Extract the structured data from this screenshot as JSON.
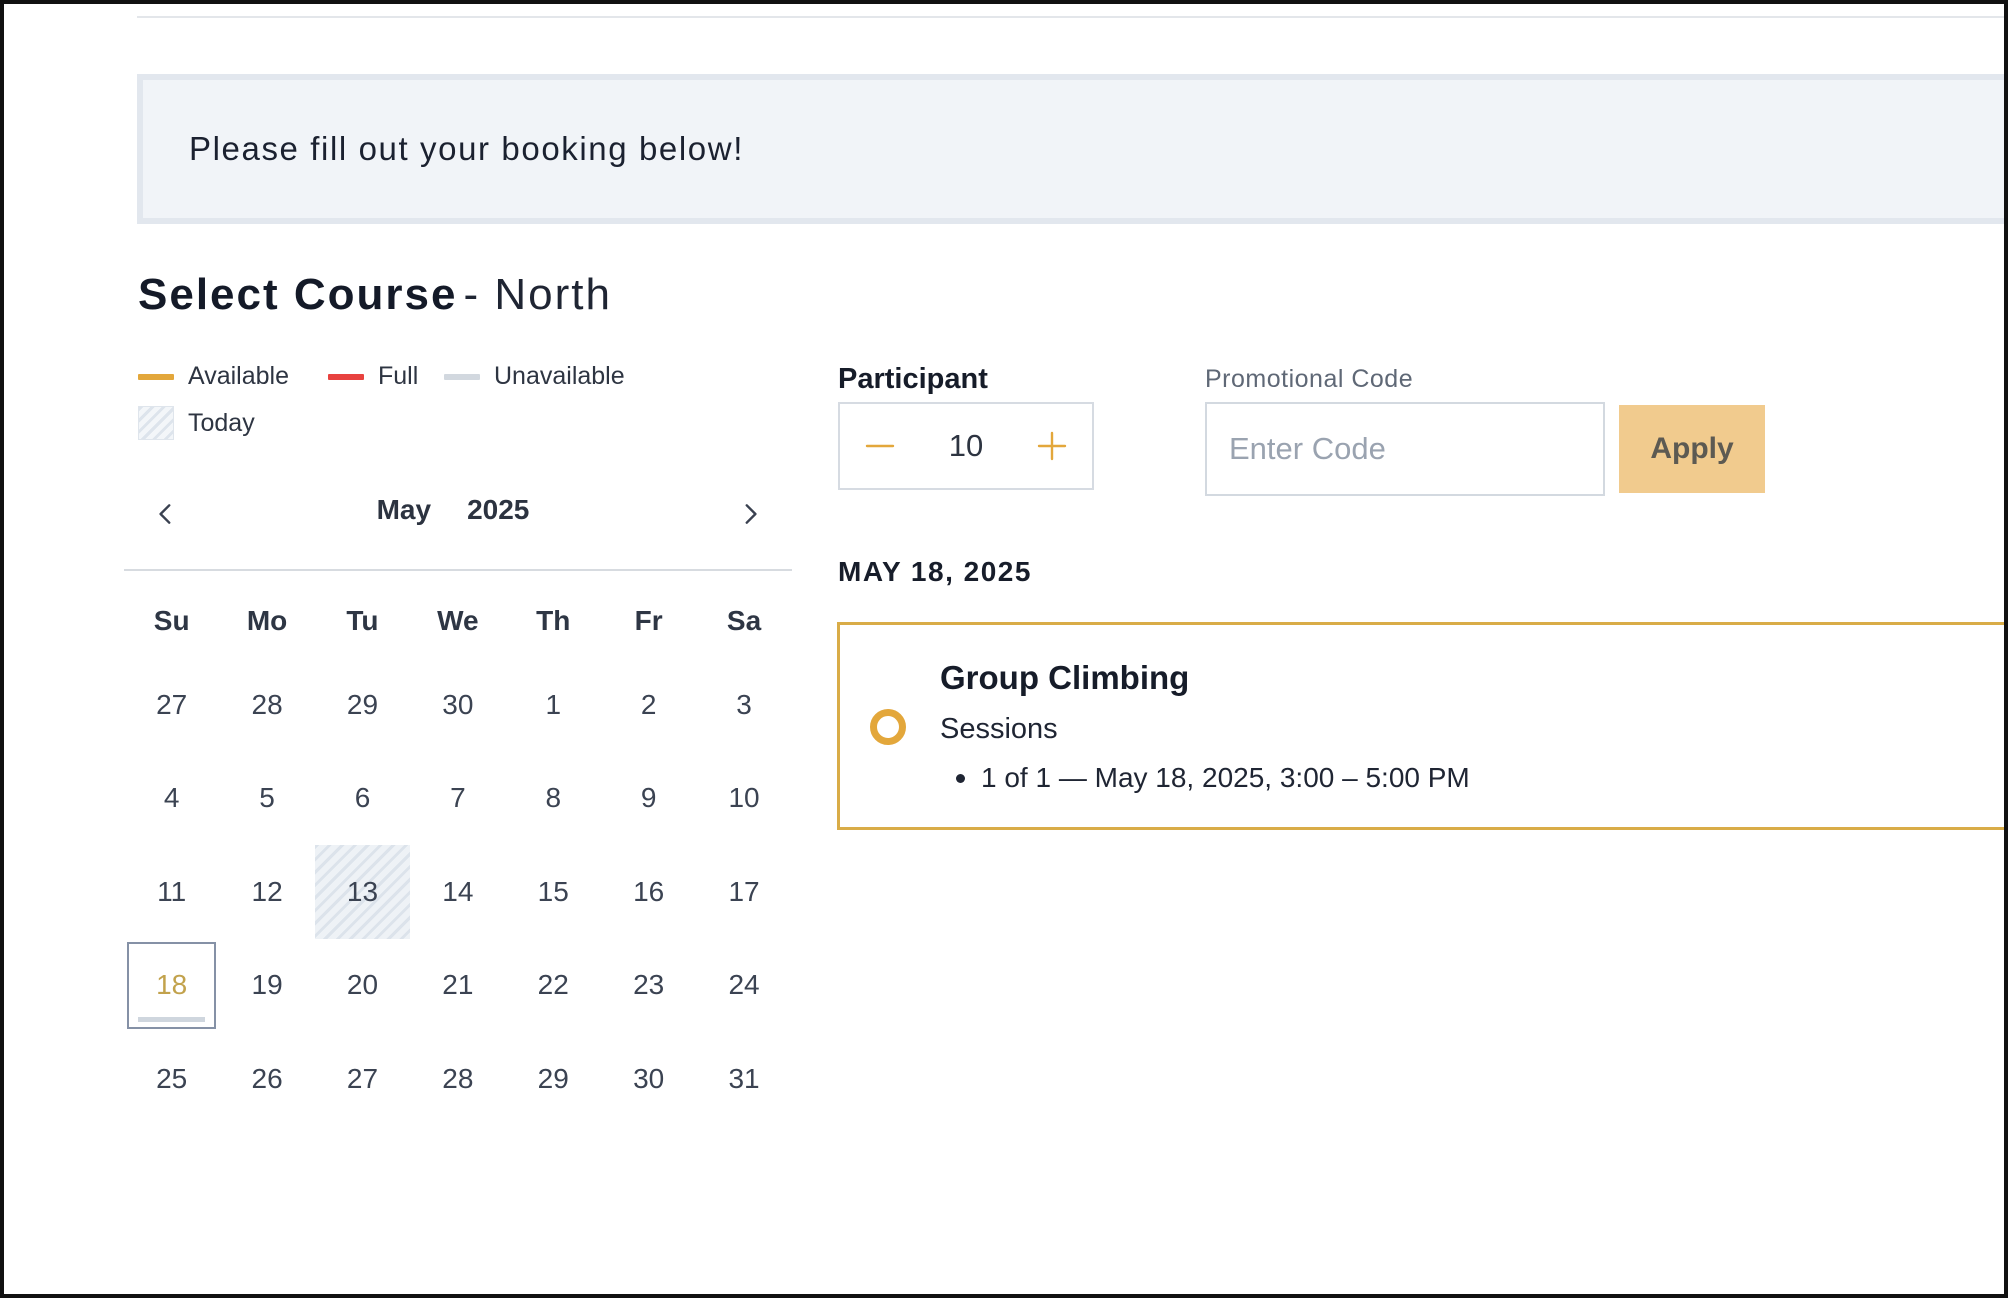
{
  "banner": {
    "text": "Please fill out your booking below!"
  },
  "course": {
    "label": "Select Course",
    "location": "- North"
  },
  "legend": {
    "available": {
      "label": "Available",
      "color": "#E3A73B"
    },
    "full": {
      "label": "Full",
      "color": "#E8423F"
    },
    "unavailable": {
      "label": "Unavailable",
      "color": "#D2D8DF"
    },
    "today": {
      "label": "Today"
    }
  },
  "calendar": {
    "month": "May",
    "year": "2025",
    "prev_icon": "chevron-left-icon",
    "next_icon": "chevron-right-icon",
    "weekdays": [
      "Su",
      "Mo",
      "Tu",
      "We",
      "Th",
      "Fr",
      "Sa"
    ],
    "weeks": [
      [
        "27",
        "28",
        "29",
        "30",
        "1",
        "2",
        "3"
      ],
      [
        "4",
        "5",
        "6",
        "7",
        "8",
        "9",
        "10"
      ],
      [
        "11",
        "12",
        "13",
        "14",
        "15",
        "16",
        "17"
      ],
      [
        "18",
        "19",
        "20",
        "21",
        "22",
        "23",
        "24"
      ],
      [
        "25",
        "26",
        "27",
        "28",
        "29",
        "30",
        "31"
      ]
    ],
    "today": "13",
    "selected": "18"
  },
  "participant": {
    "label": "Participant",
    "value": "10",
    "minus_icon": "minus-icon",
    "plus_icon": "plus-icon"
  },
  "promo": {
    "label": "Promotional Code",
    "placeholder": "Enter Code",
    "apply_label": "Apply"
  },
  "selected_date": "MAY 18, 2025",
  "session": {
    "title": "Group Climbing",
    "subtitle": "Sessions",
    "items": [
      "1 of 1 — May 18, 2025, 3:00 – 5:00 PM"
    ]
  },
  "colors": {
    "accent": "#E3A73B",
    "apply_bg": "#F1CB8E",
    "card_border": "#D9AC47"
  }
}
